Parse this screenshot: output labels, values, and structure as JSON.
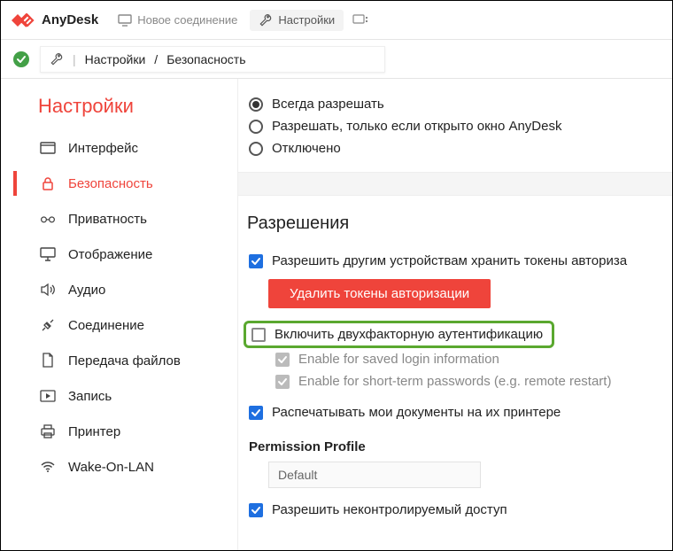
{
  "app": {
    "name": "AnyDesk"
  },
  "tabs": {
    "new_connection": "Новое соединение",
    "settings": "Настройки"
  },
  "breadcrumb": {
    "root": "Настройки",
    "leaf": "Безопасность"
  },
  "sidebar": {
    "title": "Настройки",
    "items": [
      {
        "label": "Интерфейс"
      },
      {
        "label": "Безопасность"
      },
      {
        "label": "Приватность"
      },
      {
        "label": "Отображение"
      },
      {
        "label": "Аудио"
      },
      {
        "label": "Соединение"
      },
      {
        "label": "Передача файлов"
      },
      {
        "label": "Запись"
      },
      {
        "label": "Принтер"
      },
      {
        "label": "Wake-On-LAN"
      }
    ]
  },
  "content": {
    "radio": {
      "allow_always": "Всегда разрешать",
      "allow_if_open": "Разрешать, только если открыто окно AnyDesk",
      "disabled": "Отключено"
    },
    "perms_title": "Разрешения",
    "allow_store_tokens": "Разрешить другим устройствам хранить токены авториза",
    "delete_tokens_btn": "Удалить токены авторизации",
    "enable_2fa": "Включить двухфакторную аутентификацию",
    "enable_saved_login": "Enable for saved login information",
    "enable_short_term": "Enable for short-term passwords (e.g. remote restart)",
    "print_docs": "Распечатывать мои документы на их принтере",
    "perm_profile_title": "Permission Profile",
    "perm_profile_value": "Default",
    "allow_unattended": "Разрешить неконтролируемый доступ"
  }
}
